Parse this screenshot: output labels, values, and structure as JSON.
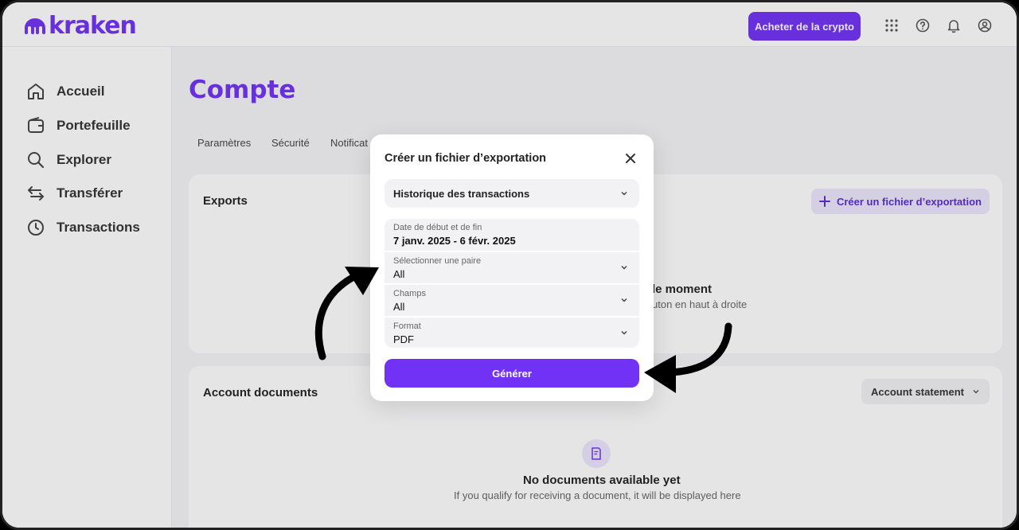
{
  "brand": {
    "logo_text": "kraken",
    "accent": "#7132f5"
  },
  "topbar": {
    "buy_button": "Acheter de la crypto",
    "icons": [
      "grid-icon",
      "help-icon",
      "bell-icon",
      "user-icon"
    ]
  },
  "sidebar": {
    "items": [
      {
        "label": "Accueil",
        "icon": "home-icon"
      },
      {
        "label": "Portefeuille",
        "icon": "wallet-icon"
      },
      {
        "label": "Explorer",
        "icon": "search-icon"
      },
      {
        "label": "Transférer",
        "icon": "transfer-icon"
      },
      {
        "label": "Transactions",
        "icon": "clock-icon"
      }
    ]
  },
  "main": {
    "title": "Compte",
    "tabs": [
      "Paramètres",
      "Sécurité",
      "Notificat"
    ]
  },
  "exports_card": {
    "title": "Exports",
    "create_button": "Créer un fichier d’exportation",
    "empty_title_partial": "le moment",
    "empty_sub_partial": "uton en haut à droite"
  },
  "documents_card": {
    "title": "Account documents",
    "select_value": "Account statement",
    "empty_title": "No documents available yet",
    "empty_sub": "If you qualify for receiving a document, it will be displayed here"
  },
  "modal": {
    "title": "Créer un fichier d’exportation",
    "type_value": "Historique des transactions",
    "date_label": "Date de début et de fin",
    "date_value": "7 janv. 2025 - 6 févr. 2025",
    "pair_label": "Sélectionner une paire",
    "pair_value": "All",
    "fields_label": "Champs",
    "fields_value": "All",
    "format_label": "Format",
    "format_value": "PDF",
    "generate_button": "Générer"
  }
}
